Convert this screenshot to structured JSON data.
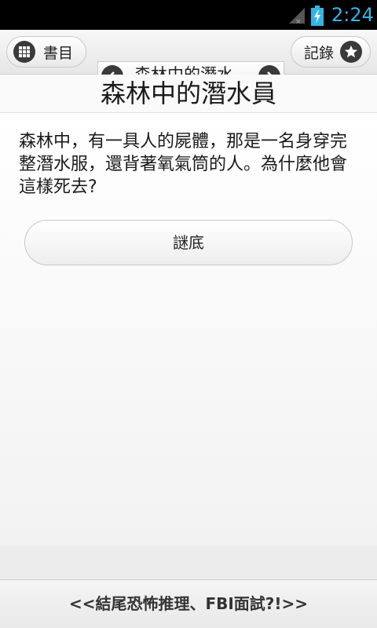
{
  "status_bar": {
    "time": "2:24",
    "accent_color": "#33b5e5"
  },
  "toolbar": {
    "catalog_label": "書目",
    "records_label": "記錄",
    "current_title": "森林中的潛水..."
  },
  "page": {
    "title": "森林中的潛水員",
    "question": "森林中，有一具人的屍體，那是一名身穿完整潛水服，還背著氧氣筒的人。為什麼他會這樣死去?",
    "answer_button_label": "謎底"
  },
  "footer": {
    "link_text": "<<結尾恐怖推理、FBI面試?!>>"
  }
}
